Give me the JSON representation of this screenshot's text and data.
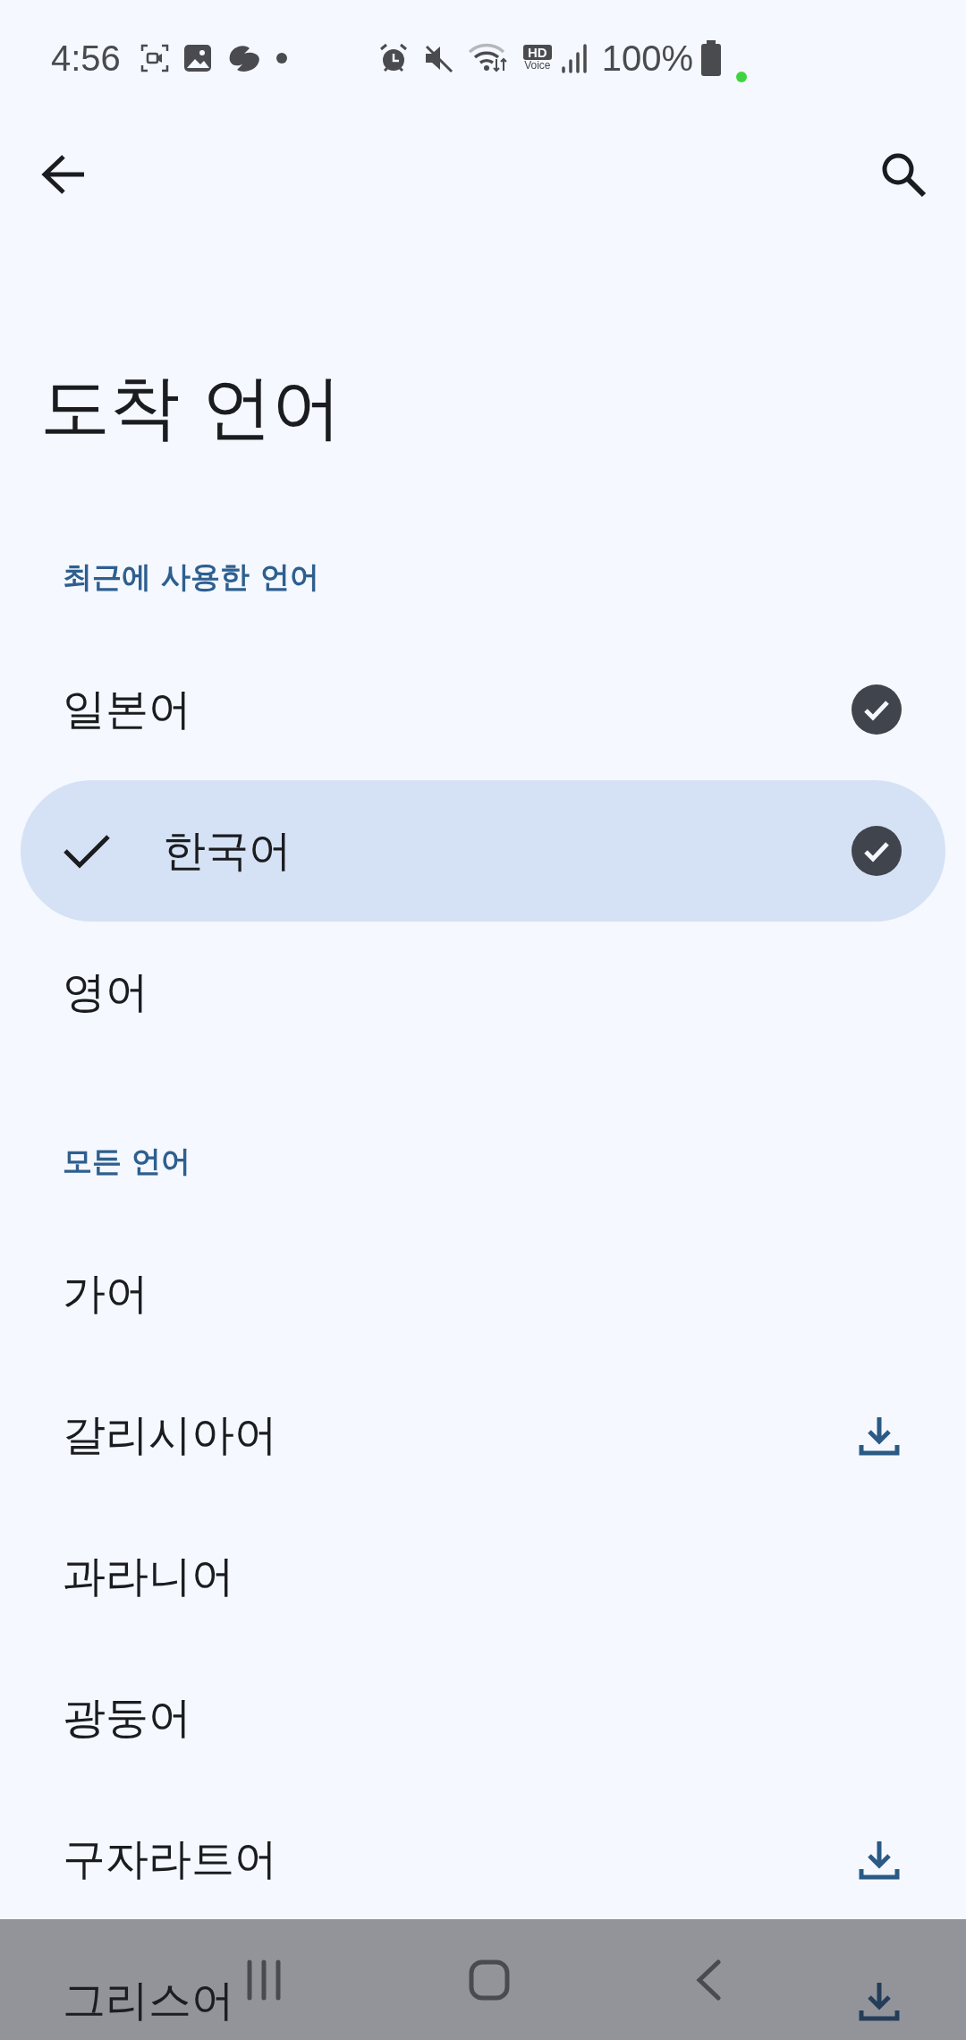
{
  "status_bar": {
    "time": "4:56",
    "hd_badge": {
      "top": "HD",
      "bottom": "Voice"
    },
    "battery": "100%"
  },
  "title": "도착 언어",
  "sections": [
    {
      "header": "최근에 사용한 언어",
      "items": [
        {
          "label": "일본어",
          "selected": false,
          "kind": "downloaded"
        },
        {
          "label": "한국어",
          "selected": true,
          "kind": "downloaded"
        },
        {
          "label": "영어",
          "selected": false,
          "kind": "plain"
        }
      ]
    },
    {
      "header": "모든 언어",
      "items": [
        {
          "label": "가어",
          "selected": false,
          "kind": "plain"
        },
        {
          "label": "갈리시아어",
          "selected": false,
          "kind": "download"
        },
        {
          "label": "과라니어",
          "selected": false,
          "kind": "plain"
        },
        {
          "label": "광둥어",
          "selected": false,
          "kind": "plain"
        },
        {
          "label": "구자라트어",
          "selected": false,
          "kind": "download"
        },
        {
          "label": "그리스어",
          "selected": false,
          "kind": "download"
        }
      ]
    }
  ]
}
